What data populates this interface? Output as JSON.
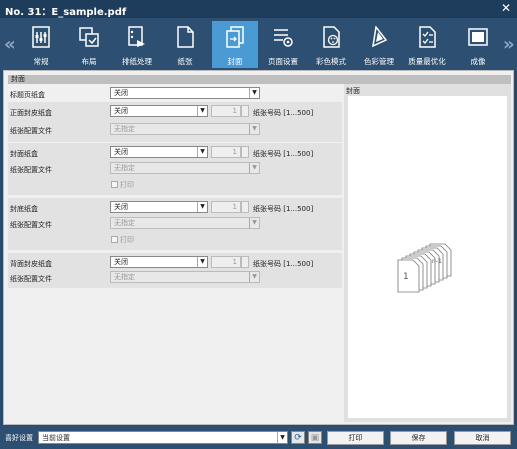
{
  "window": {
    "title": "No. 31：E_sample.pdf",
    "close_label": "✕"
  },
  "toolbar": {
    "prev_label": "«",
    "next_label": "»",
    "tabs": [
      {
        "label": "常规",
        "icon": "general-settings-icon"
      },
      {
        "label": "布局",
        "icon": "layout-icon"
      },
      {
        "label": "排纸处理",
        "icon": "finishing-icon"
      },
      {
        "label": "纸张",
        "icon": "paper-icon"
      },
      {
        "label": "封面",
        "icon": "cover-icon",
        "active": true
      },
      {
        "label": "页面设置",
        "icon": "page-settings-icon"
      },
      {
        "label": "彩色模式",
        "icon": "color-mode-icon"
      },
      {
        "label": "色彩管理",
        "icon": "color-management-icon"
      },
      {
        "label": "质量最优化",
        "icon": "quality-icon"
      },
      {
        "label": "成像",
        "icon": "imaging-icon"
      }
    ]
  },
  "section": {
    "title": "封面"
  },
  "form": {
    "title_tray": {
      "label": "标题页纸盒",
      "value": "关闭"
    },
    "front_cover": {
      "label": "正面封皮纸盒",
      "value": "关闭",
      "number": "1",
      "range": "纸张号码 [1...500]",
      "profile_label": "纸张配置文件",
      "profile_value": "无指定"
    },
    "cover_tray": {
      "label": "封面纸盒",
      "value": "关闭",
      "number": "1",
      "range": "纸张号码 [1...500]",
      "profile_label": "纸张配置文件",
      "profile_value": "无指定",
      "print_label": "打印"
    },
    "back_cover_tray": {
      "label": "封底纸盒",
      "value": "关闭",
      "number": "1",
      "range": "纸张号码 [1...500]",
      "profile_label": "纸张配置文件",
      "profile_value": "无指定",
      "print_label": "打印"
    },
    "rear_cover": {
      "label": "背面封皮纸盒",
      "value": "关闭",
      "number": "1",
      "range": "纸张号码 [1...500]",
      "profile_label": "纸张配置文件",
      "profile_value": "无指定"
    }
  },
  "preview": {
    "title": "封面",
    "first_page": "1",
    "last_page": "n-1"
  },
  "bottom": {
    "favorites_label": "喜好设置",
    "favorites_value": "当前设置",
    "print_label": "打印",
    "save_label": "保存",
    "cancel_label": "取消"
  }
}
